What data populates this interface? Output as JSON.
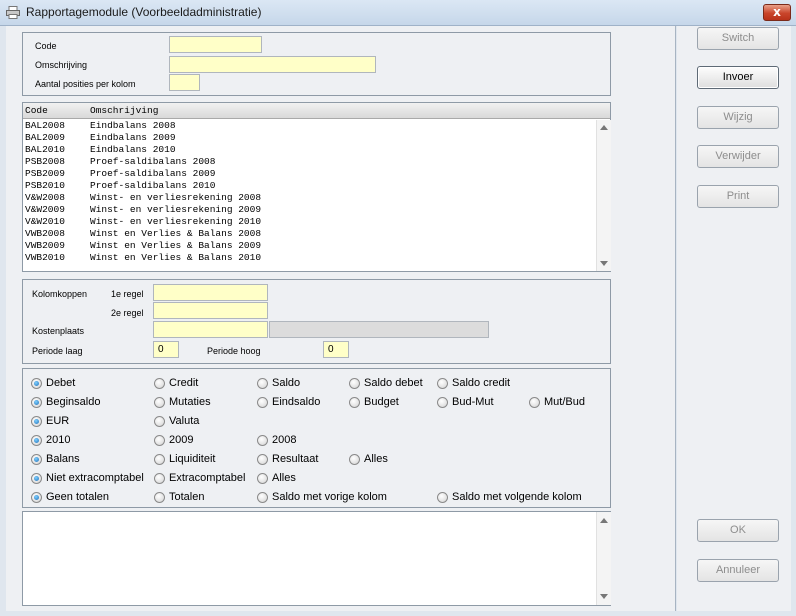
{
  "window": {
    "title": "Rapportagemodule (Voorbeeldadministratie)",
    "close_glyph": "x",
    "icon": "printer-icon"
  },
  "form": {
    "code_label": "Code",
    "code_value": "",
    "description_label": "Omschrijving",
    "description_value": "",
    "positions_label": "Aantal posities per kolom",
    "positions_value": ""
  },
  "list": {
    "headers": {
      "code": "Code",
      "description": "Omschrijving"
    },
    "rows": [
      {
        "code": "BAL2008",
        "description": "Eindbalans 2008"
      },
      {
        "code": "BAL2009",
        "description": "Eindbalans 2009"
      },
      {
        "code": "BAL2010",
        "description": "Eindbalans 2010"
      },
      {
        "code": "PSB2008",
        "description": "Proef-saldibalans 2008"
      },
      {
        "code": "PSB2009",
        "description": "Proef-saldibalans 2009"
      },
      {
        "code": "PSB2010",
        "description": "Proef-saldibalans 2010"
      },
      {
        "code": "V&W2008",
        "description": "Winst- en verliesrekening 2008"
      },
      {
        "code": "V&W2009",
        "description": "Winst- en verliesrekening 2009"
      },
      {
        "code": "V&W2010",
        "description": "Winst- en verliesrekening 2010"
      },
      {
        "code": "VWB2008",
        "description": "Winst en Verlies & Balans 2008"
      },
      {
        "code": "VWB2009",
        "description": "Winst en Verlies & Balans 2009"
      },
      {
        "code": "VWB2010",
        "description": "Winst en Verlies & Balans 2010"
      }
    ]
  },
  "columns": {
    "heading_label": "Kolomkoppen",
    "line1_label": "1e regel",
    "line1_value": "",
    "line2_label": "2e regel",
    "line2_value": "",
    "costcenter_label": "Kostenplaats",
    "costcenter_value": "",
    "period_low_label": "Periode laag",
    "period_low_value": "0",
    "period_high_label": "Periode hoog",
    "period_high_value": "0"
  },
  "options": {
    "rows": [
      [
        {
          "label": "Debet",
          "checked": true
        },
        {
          "label": "Credit",
          "checked": false
        },
        {
          "label": "Saldo",
          "checked": false
        },
        {
          "label": "Saldo debet",
          "checked": false
        },
        {
          "label": "Saldo credit",
          "checked": false
        }
      ],
      [
        {
          "label": "Beginsaldo",
          "checked": true
        },
        {
          "label": "Mutaties",
          "checked": false
        },
        {
          "label": "Eindsaldo",
          "checked": false
        },
        {
          "label": "Budget",
          "checked": false
        },
        {
          "label": "Bud-Mut",
          "checked": false
        },
        {
          "label": "Mut/Bud",
          "checked": false
        }
      ],
      [
        {
          "label": "EUR",
          "checked": true
        },
        {
          "label": "Valuta",
          "checked": false
        }
      ],
      [
        {
          "label": "2010",
          "checked": true
        },
        {
          "label": "2009",
          "checked": false
        },
        {
          "label": "2008",
          "checked": false
        }
      ],
      [
        {
          "label": "Balans",
          "checked": true
        },
        {
          "label": "Liquiditeit",
          "checked": false
        },
        {
          "label": "Resultaat",
          "checked": false
        },
        {
          "label": "Alles",
          "checked": false
        }
      ],
      [
        {
          "label": "Niet extracomptabel",
          "checked": true
        },
        {
          "label": "Extracomptabel",
          "checked": false
        },
        {
          "label": "Alles",
          "checked": false
        }
      ],
      [
        {
          "label": "Geen totalen",
          "checked": true
        },
        {
          "label": "Totalen",
          "checked": false
        },
        {
          "label": "Saldo met vorige kolom",
          "checked": false
        },
        {
          "label": "Saldo met volgende kolom",
          "checked": false
        }
      ]
    ]
  },
  "buttons": {
    "switch": "Switch",
    "invoer": "Invoer",
    "wijzig": "Wijzig",
    "verwijder": "Verwijder",
    "print": "Print",
    "ok": "OK",
    "annuleer": "Annuleer"
  },
  "memo": {
    "value": ""
  }
}
